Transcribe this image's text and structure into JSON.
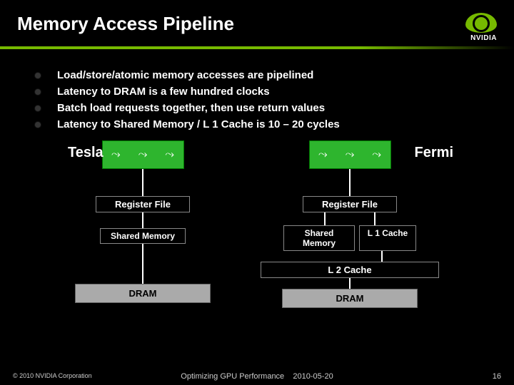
{
  "header": {
    "title": "Memory Access Pipeline",
    "brand": "NVIDIA"
  },
  "bullets": [
    "Load/store/atomic memory accesses are pipelined",
    "Latency to DRAM is a few hundred clocks",
    "Batch load requests together, then use return values",
    "Latency to Shared Memory / L 1 Cache is 10 – 20 cycles"
  ],
  "diagram": {
    "tesla": {
      "label": "Tesla",
      "register_file": "Register File",
      "shared_memory": "Shared Memory",
      "dram": "DRAM"
    },
    "fermi": {
      "label": "Fermi",
      "register_file": "Register File",
      "shared_memory": "Shared Memory",
      "l1": "L 1 Cache",
      "l2": "L 2 Cache",
      "dram": "DRAM"
    }
  },
  "footer": {
    "copyright": "© 2010 NVIDIA Corporation",
    "center_title": "Optimizing GPU Performance",
    "date": "2010-05-20",
    "slide": "16"
  }
}
